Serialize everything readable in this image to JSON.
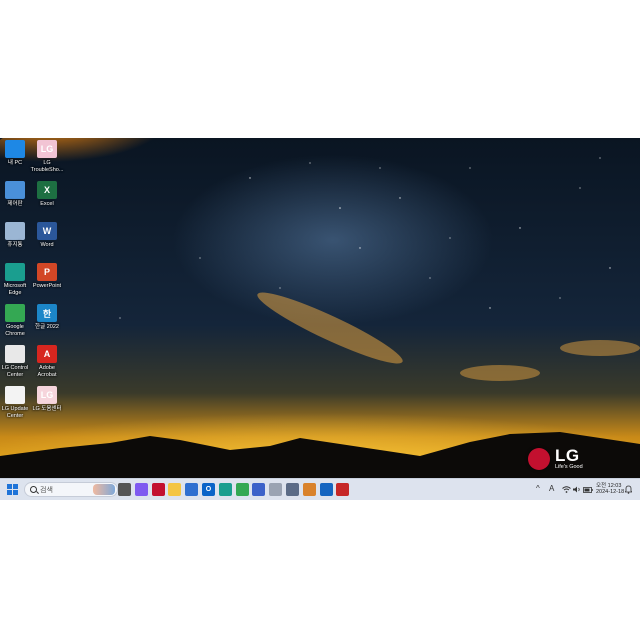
{
  "desktop": {
    "icons": [
      {
        "label": "내 PC",
        "icon": "computer-icon",
        "color": "#1e88e5",
        "glyph": ""
      },
      {
        "label": "LG\nTroubleSho...",
        "icon": "lg-troubleshooter-icon",
        "color": "#f2c4d4",
        "glyph": "LG"
      },
      {
        "label": "제어판",
        "icon": "control-panel-icon",
        "color": "#4a90d9",
        "glyph": ""
      },
      {
        "label": "Excel",
        "icon": "excel-icon",
        "color": "#1d6f42",
        "glyph": "X"
      },
      {
        "label": "휴지통",
        "icon": "recycle-bin-icon",
        "color": "#9bb6d4",
        "glyph": ""
      },
      {
        "label": "Word",
        "icon": "word-icon",
        "color": "#2b579a",
        "glyph": "W"
      },
      {
        "label": "Microsoft\nEdge",
        "icon": "edge-icon",
        "color": "#1a9e8f",
        "glyph": ""
      },
      {
        "label": "PowerPoint",
        "icon": "powerpoint-icon",
        "color": "#d24726",
        "glyph": "P"
      },
      {
        "label": "Google\nChrome",
        "icon": "chrome-icon",
        "color": "#34a853",
        "glyph": ""
      },
      {
        "label": "한글 2022",
        "icon": "hangul-icon",
        "color": "#1c86c8",
        "glyph": "한"
      },
      {
        "label": "LG Control\nCenter",
        "icon": "lg-control-center-icon",
        "color": "#e8e8e8",
        "glyph": ""
      },
      {
        "label": "Adobe\nAcrobat",
        "icon": "acrobat-icon",
        "color": "#d7261f",
        "glyph": "A"
      },
      {
        "label": "LG Update\nCenter",
        "icon": "lg-update-center-icon",
        "color": "#f3f3f3",
        "glyph": ""
      },
      {
        "label": "LG 도움센터",
        "icon": "lg-help-center-icon",
        "color": "#f6d5dc",
        "glyph": "LG"
      }
    ]
  },
  "branding": {
    "logo_text": "LG",
    "tagline": "Life's Good",
    "accent": "#c3102f"
  },
  "taskbar": {
    "search": {
      "placeholder": "검색"
    },
    "apps": [
      {
        "icon": "file-explorer-small-icon",
        "color": "#555555",
        "glyph": ""
      },
      {
        "icon": "copilot-icon",
        "color": "#7f5af0",
        "glyph": ""
      },
      {
        "icon": "lg-app-icon",
        "color": "#c3102f",
        "glyph": ""
      },
      {
        "icon": "file-explorer-icon",
        "color": "#f4c542",
        "glyph": ""
      },
      {
        "icon": "microsoft-store-icon",
        "color": "#2f6fd0",
        "glyph": ""
      },
      {
        "icon": "outlook-icon",
        "color": "#0a64c8",
        "glyph": "O"
      },
      {
        "icon": "edge-taskbar-icon",
        "color": "#1a9e8f",
        "glyph": ""
      },
      {
        "icon": "chrome-taskbar-icon",
        "color": "#34a853",
        "glyph": ""
      },
      {
        "icon": "app-blue-icon",
        "color": "#3c62c9",
        "glyph": ""
      },
      {
        "icon": "app-gray-icon",
        "color": "#9aa3b2",
        "glyph": ""
      },
      {
        "icon": "snipping-tool-icon",
        "color": "#5b6b86",
        "glyph": ""
      },
      {
        "icon": "app-orange-icon",
        "color": "#d9822b",
        "glyph": ""
      },
      {
        "icon": "defender-icon",
        "color": "#1565c0",
        "glyph": ""
      },
      {
        "icon": "app-red-icon",
        "color": "#c62828",
        "glyph": ""
      }
    ],
    "tray": {
      "chevron": "^",
      "ime": "A",
      "time": "오전 12:03",
      "date": "2024-12-18"
    }
  }
}
